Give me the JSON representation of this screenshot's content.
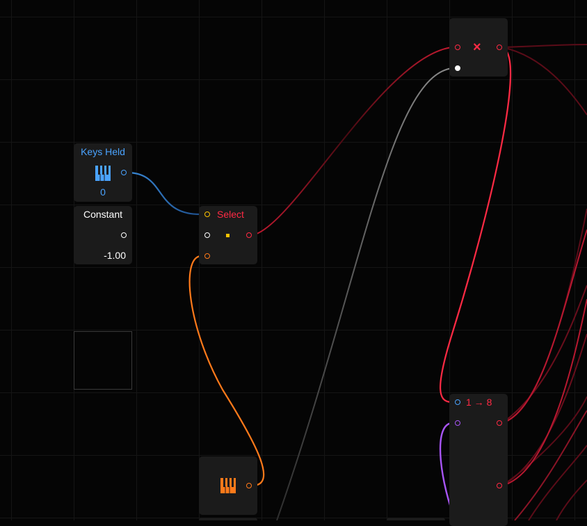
{
  "canvas": {
    "grid_color": "#151515",
    "background": "#050505"
  },
  "nodes": {
    "keys_held": {
      "title": "Keys Held",
      "value": "0",
      "icon": "piano-keys-icon",
      "color": "#4aa3ff"
    },
    "constant": {
      "title": "Constant",
      "value": "-1.00",
      "color": "#ffffff"
    },
    "select": {
      "title": "Select",
      "color": "#ff2a44",
      "indicator_color": "#ffc400"
    },
    "multiply": {
      "symbol": "×",
      "color": "#ff2a44"
    },
    "split": {
      "title": "1 → 8",
      "color": "#ff2a44"
    },
    "keyboard_bottom": {
      "icon": "piano-keys-icon",
      "color": "#ff7a1a"
    }
  },
  "wire_colors": {
    "blue": "#2a6fbf",
    "white": "#e8e8e8",
    "orange": "#ff7a1a",
    "red": "#ff2a44",
    "dark_red": "#7a1020",
    "gray": "#6a6a6a",
    "purple": "#a855f7"
  }
}
